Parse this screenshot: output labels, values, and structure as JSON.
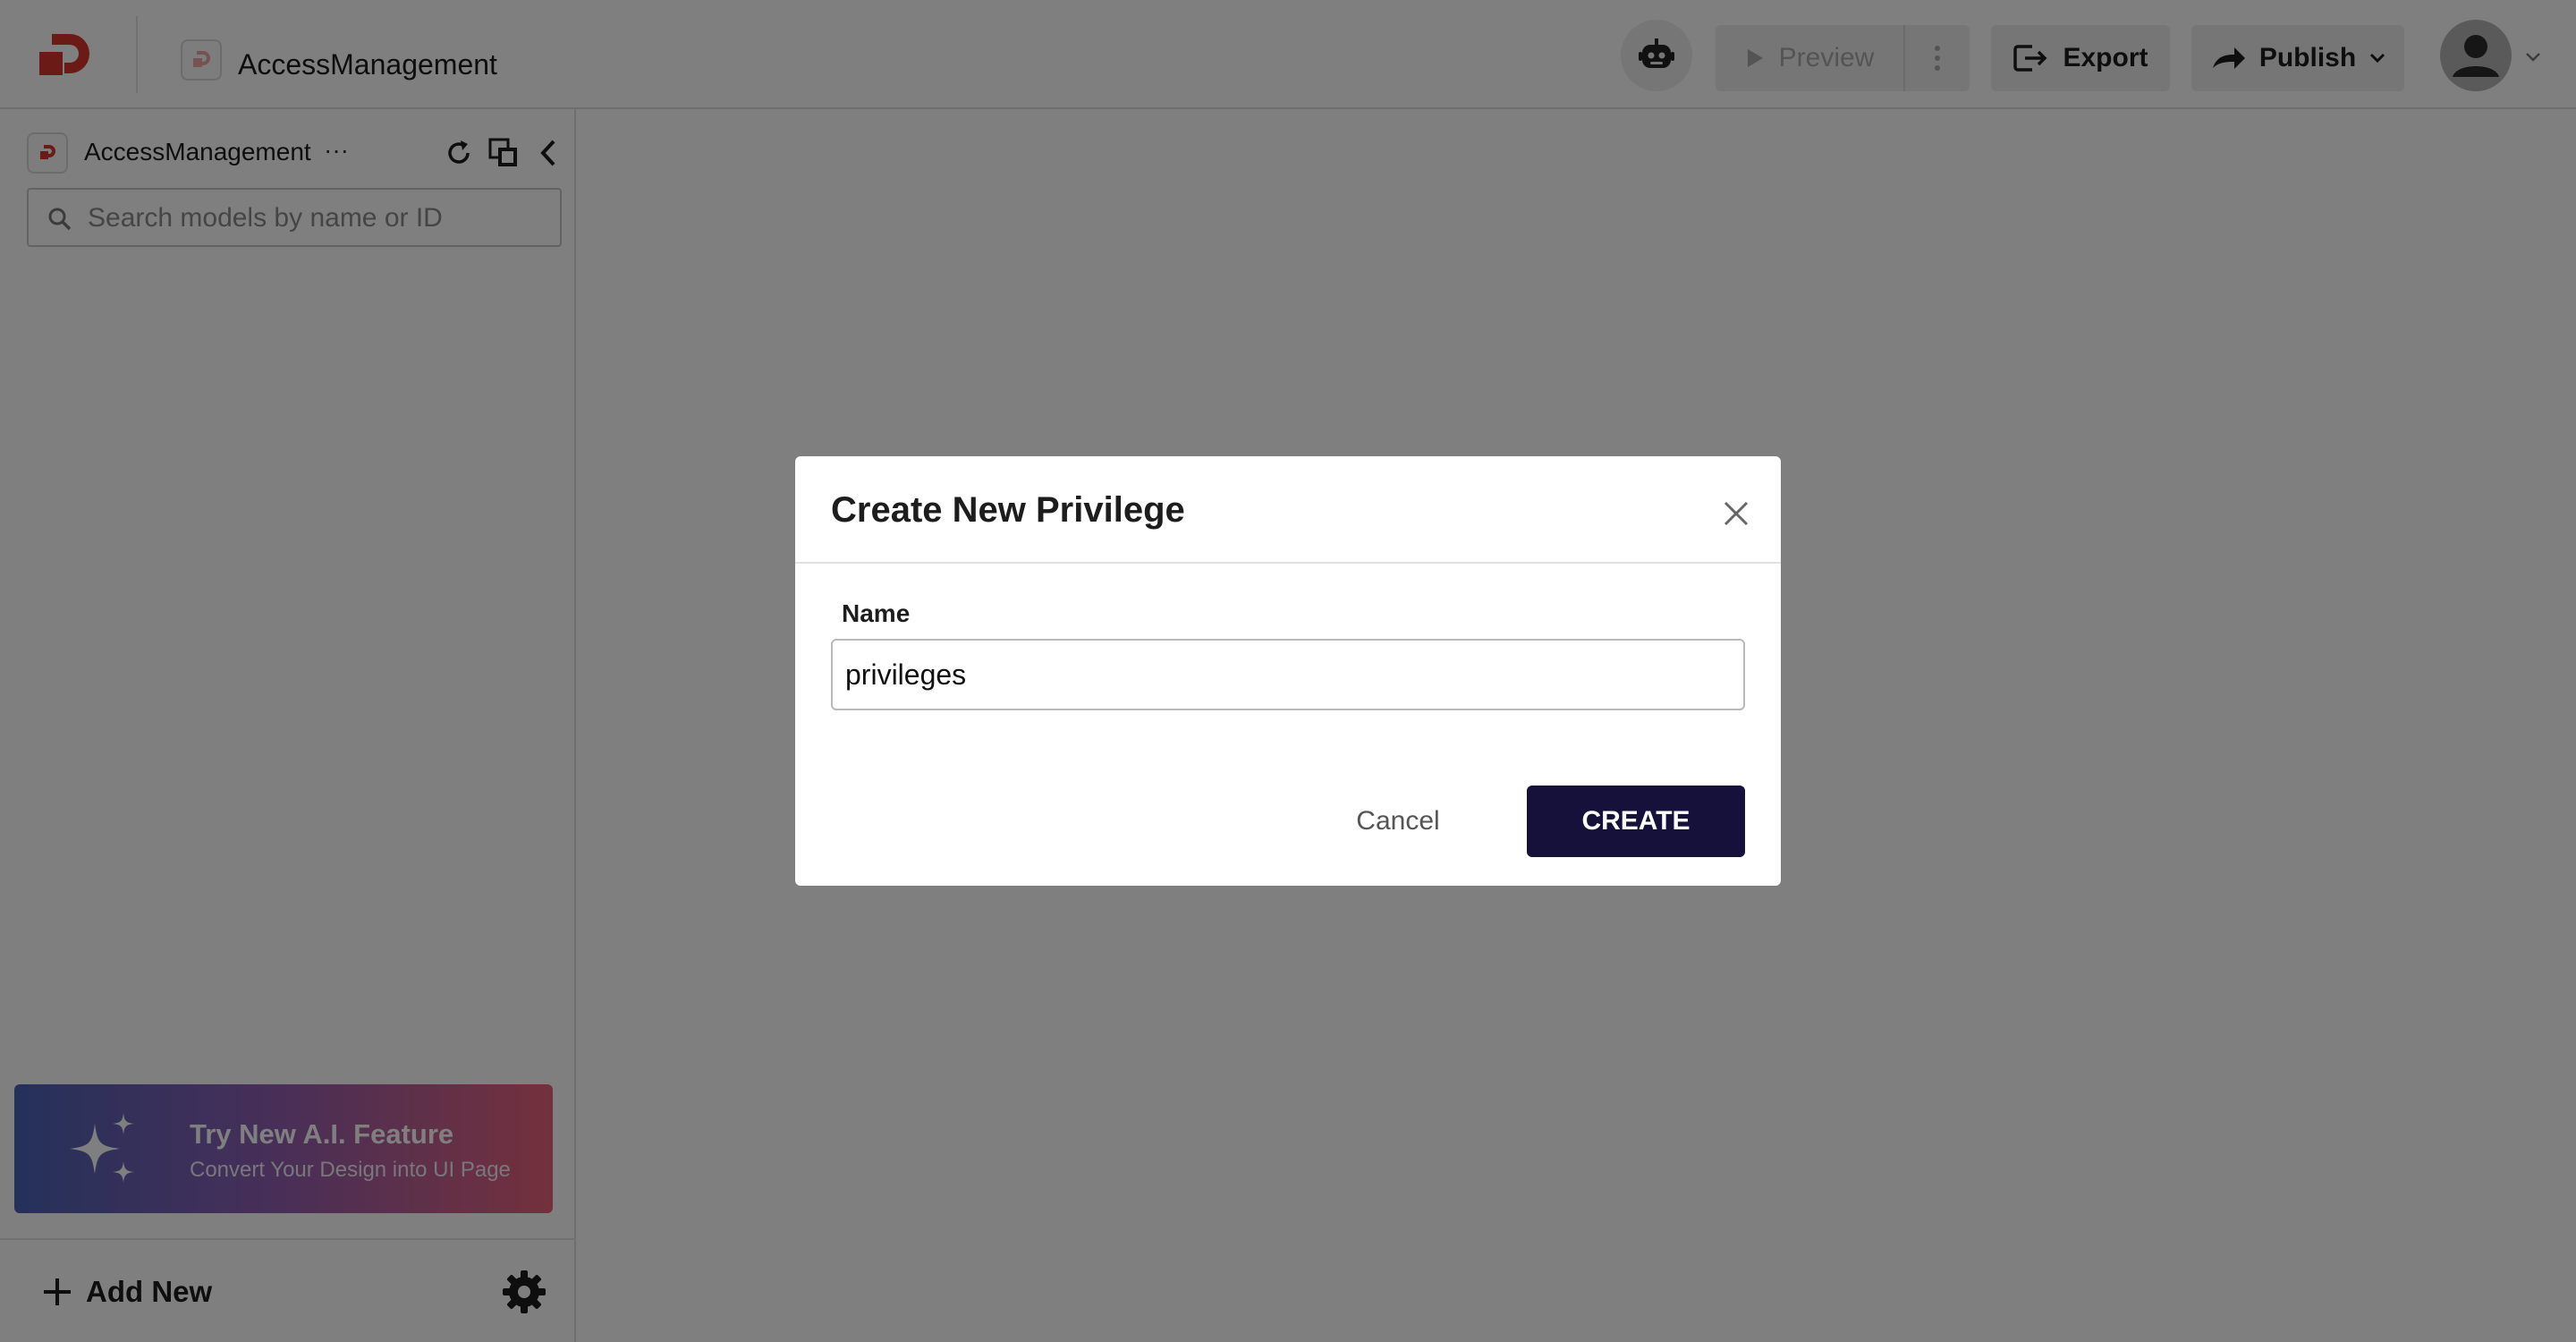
{
  "topbar": {
    "project_title": "AccessManagement",
    "preview_label": "Preview",
    "export_label": "Export",
    "publish_label": "Publish"
  },
  "sidebar": {
    "project_name": "AccessManagement",
    "ellipsis": "···",
    "search_placeholder": "Search models by name or ID",
    "ai_banner": {
      "title": "Try New A.I. Feature",
      "subtitle": "Convert Your Design into UI Page"
    },
    "add_new_label": "Add New"
  },
  "modal": {
    "title": "Create New Privilege",
    "name_label": "Name",
    "name_value": "privileges",
    "cancel_label": "Cancel",
    "create_label": "CREATE"
  },
  "colors": {
    "brand_red": "#d9342b",
    "primary_dark": "#15113a",
    "overlay": "rgba(0,0,0,0.5)"
  },
  "icons": [
    "logo-icon",
    "bot-icon",
    "play-icon",
    "more-vertical-icon",
    "export-icon",
    "share-arrow-icon",
    "chevron-down-icon",
    "user-avatar-icon",
    "refresh-icon",
    "copy-icon",
    "chevron-left-icon",
    "search-icon",
    "sparkle-icon",
    "plus-icon",
    "gear-icon",
    "close-icon"
  ]
}
